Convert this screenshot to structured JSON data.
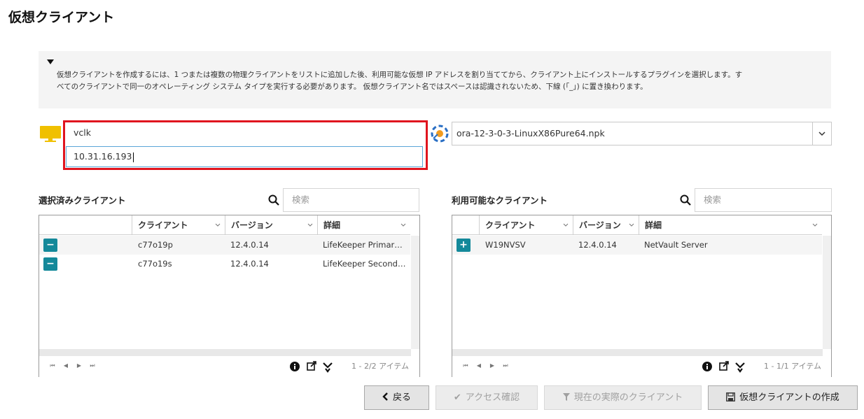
{
  "page": {
    "title": "仮想クライアント"
  },
  "info": {
    "line1": "仮想クライアントを作成するには、1 つまたは複数の物理クライアントをリストに追加した後、利用可能な仮想 IP アドレスを割り当ててから、クライアント上にインストールするプラグインを選択します。す",
    "line2": "べてのクライアントで同一のオペレーティング システム タイプを実行する必要があります。 仮想クライアント名ではスペースは認識されないため、下線 (「_」) に置き換わります。"
  },
  "form": {
    "name_value": "vclk",
    "ip_value": "10.31.16.193",
    "plugin_value": "ora-12-3-0-3-LinuxX86Pure64.npk"
  },
  "selected": {
    "label": "選択済みクライアント",
    "search_placeholder": "検索",
    "columns": [
      "クライアント",
      "バージョン",
      "詳細"
    ],
    "rows": [
      {
        "btn": "−",
        "client": "c77o19p",
        "version": "12.4.0.14",
        "detail": "LifeKeeper Primary Server"
      },
      {
        "btn": "−",
        "client": "c77o19s",
        "version": "12.4.0.14",
        "detail": "LifeKeeper Secondary Server"
      }
    ],
    "count": "1 - 2/2 アイテム"
  },
  "available": {
    "label": "利用可能なクライアント",
    "search_placeholder": "検索",
    "columns": [
      "クライアント",
      "バージョン",
      "詳細"
    ],
    "rows": [
      {
        "btn": "+",
        "client": "W19NVSV",
        "version": "12.4.0.14",
        "detail": "NetVault Server"
      }
    ],
    "count": "1 - 1/1 アイテム"
  },
  "pager": {
    "first": "⏮",
    "prev": "◀",
    "next": "▶",
    "last": "⏭"
  },
  "buttons": {
    "back": "戻る",
    "check_access": "アクセス確認",
    "current_clients": "現在の実際のクライアント",
    "create": "仮想クライアントの作成"
  },
  "colors": {
    "accent": "#14899a",
    "highlight": "#e0141e",
    "monitor": "#f0c000"
  }
}
